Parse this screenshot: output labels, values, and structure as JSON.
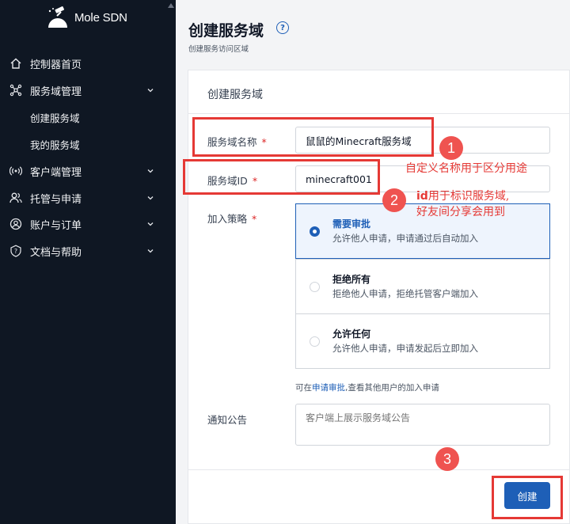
{
  "app": {
    "logo_text": "Mole SDN"
  },
  "sidebar": {
    "items": [
      {
        "label": "控制器首页",
        "icon": "home-icon",
        "has_children": false
      },
      {
        "label": "服务域管理",
        "icon": "network-icon",
        "has_children": true
      },
      {
        "label": "客户端管理",
        "icon": "signal-icon",
        "has_children": true
      },
      {
        "label": "托管与申请",
        "icon": "users-icon",
        "has_children": true
      },
      {
        "label": "账户与订单",
        "icon": "user-circle-icon",
        "has_children": true
      },
      {
        "label": "文档与帮助",
        "icon": "help-shield-icon",
        "has_children": true
      }
    ],
    "subitems": [
      {
        "label": "创建服务域"
      },
      {
        "label": "我的服务域"
      }
    ]
  },
  "page": {
    "title": "创建服务域",
    "subtitle": "创建服务访问区域"
  },
  "form": {
    "card_title": "创建服务域",
    "name_label": "服务域名称",
    "name_value": "鼠鼠的Minecraft服务域",
    "id_label": "服务域ID",
    "id_value": "minecraft001",
    "required_mark": "*",
    "policy_label": "加入策略",
    "policy_options": [
      {
        "title": "需要审批",
        "desc": "允许他人申请，申请通过后自动加入",
        "selected": true
      },
      {
        "title": "拒绝所有",
        "desc": "拒绝他人申请，拒绝托管客户端加入",
        "selected": false
      },
      {
        "title": "允许任何",
        "desc": "允许他人申请，申请发起后立即加入",
        "selected": false
      }
    ],
    "hint_prefix": "可在",
    "hint_link": "申请审批",
    "hint_suffix": ",查看其他用户的加入申请",
    "notice_label": "通知公告",
    "notice_placeholder": "客户端上展示服务域公告",
    "submit_label": "创建"
  },
  "annotations": {
    "badge1": "1",
    "badge2": "2",
    "badge3": "3",
    "note1": "自定义名称用于区分用途",
    "note2_bold": "id",
    "note2_line1_rest": "用于标识服务域,",
    "note2_line2": "好友间分享会用到"
  },
  "colors": {
    "accent": "#1e5fb7",
    "sidebar_bg": "#0f1723",
    "annotation": "#e53935",
    "required": "#dc2626"
  }
}
